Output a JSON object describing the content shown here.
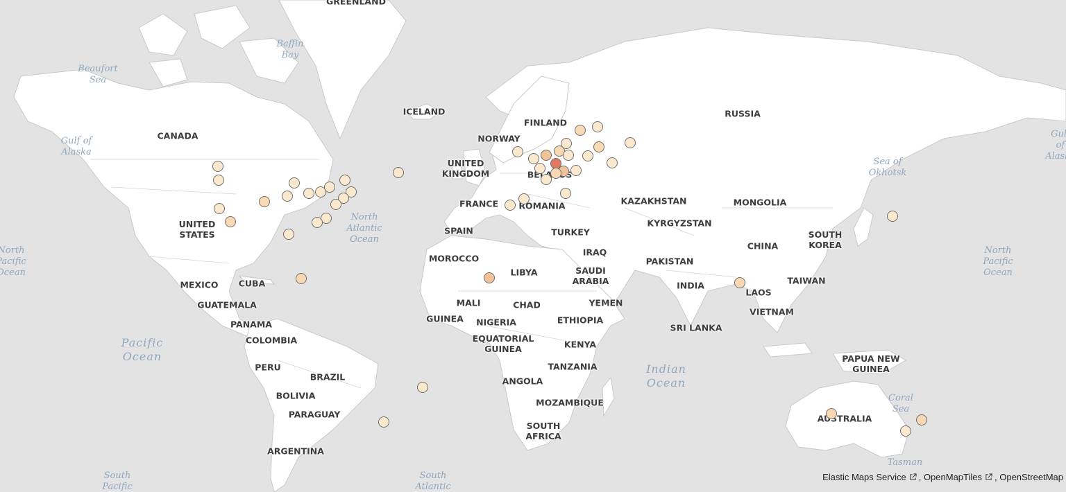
{
  "map": {
    "country_labels": [
      "GREENLAND",
      "ICELAND",
      "CANADA",
      "UNITED STATES",
      "MEXICO",
      "CUBA",
      "GUATEMALA",
      "PANAMA",
      "COLOMBIA",
      "PERU",
      "BRAZIL",
      "BOLIVIA",
      "PARAGUAY",
      "ARGENTINA",
      "NORWAY",
      "FINLAND",
      "UNITED KINGDOM",
      "BELARUS",
      "FRANCE",
      "ROMANIA",
      "SPAIN",
      "MOROCCO",
      "LIBYA",
      "TURKEY",
      "IRAQ",
      "SAUDI ARABIA",
      "YEMEN",
      "MALI",
      "CHAD",
      "GUINEA",
      "NIGERIA",
      "ETHIOPIA",
      "EQUATORIAL GUINEA",
      "KENYA",
      "TANZANIA",
      "ANGOLA",
      "MOZAMBIQUE",
      "SOUTH AFRICA",
      "RUSSIA",
      "KAZAKHSTAN",
      "KYRGYZSTAN",
      "MONGOLIA",
      "CHINA",
      "SOUTH KOREA",
      "PAKISTAN",
      "INDIA",
      "SRI LANKA",
      "LAOS",
      "VIETNAM",
      "TAIWAN",
      "PAPUA NEW GUINEA",
      "AUSTRALIA"
    ],
    "water_labels": [
      "Beaufort Sea",
      "Baffin Bay",
      "Gulf of Alaska",
      "North Atlantic Ocean",
      "North Pacific Ocean",
      "North Pacific Ocean",
      "Pacific Ocean",
      "Indian Ocean",
      "Sea of Okhotsk",
      "Coral Sea",
      "Tasman",
      "South Pacific",
      "South Atlantic",
      "Gulf of Alaska"
    ],
    "points": [
      {
        "lat": 49.3,
        "lon": -123.1,
        "level": 1
      },
      {
        "lat": 45.5,
        "lon": -122.7,
        "level": 1
      },
      {
        "lat": 37.8,
        "lon": -122.4,
        "level": 1
      },
      {
        "lat": 34.0,
        "lon": -118.2,
        "level": 2
      },
      {
        "lat": 39.7,
        "lon": -105.0,
        "level": 2
      },
      {
        "lat": 41.2,
        "lon": -96.0,
        "level": 1
      },
      {
        "lat": 44.9,
        "lon": -93.2,
        "level": 1
      },
      {
        "lat": 41.9,
        "lon": -87.6,
        "level": 1
      },
      {
        "lat": 42.3,
        "lon": -83.0,
        "level": 1
      },
      {
        "lat": 43.7,
        "lon": -79.4,
        "level": 1
      },
      {
        "lat": 45.5,
        "lon": -73.6,
        "level": 1
      },
      {
        "lat": 42.4,
        "lon": -71.1,
        "level": 1
      },
      {
        "lat": 40.7,
        "lon": -74.0,
        "level": 1
      },
      {
        "lat": 38.9,
        "lon": -77.0,
        "level": 1
      },
      {
        "lat": 35.2,
        "lon": -80.8,
        "level": 1
      },
      {
        "lat": 33.7,
        "lon": -84.4,
        "level": 1
      },
      {
        "lat": 29.7,
        "lon": -95.4,
        "level": 1
      },
      {
        "lat": 47.6,
        "lon": -52.7,
        "level": 1
      },
      {
        "lat": 14.6,
        "lon": -90.5,
        "level": 2
      },
      {
        "lat": -22.9,
        "lon": -43.2,
        "level": 1
      },
      {
        "lat": -34.6,
        "lon": -58.4,
        "level": 1
      },
      {
        "lat": 14.7,
        "lon": -17.4,
        "level": 3
      },
      {
        "lat": 53.3,
        "lon": -6.3,
        "level": 1
      },
      {
        "lat": 51.5,
        "lon": -0.1,
        "level": 1
      },
      {
        "lat": 48.9,
        "lon": 2.3,
        "level": 1
      },
      {
        "lat": 45.8,
        "lon": 4.8,
        "level": 1
      },
      {
        "lat": 40.4,
        "lon": -3.7,
        "level": 1
      },
      {
        "lat": 38.7,
        "lon": -9.1,
        "level": 1
      },
      {
        "lat": 52.4,
        "lon": 4.9,
        "level": 3
      },
      {
        "lat": 53.6,
        "lon": 10.0,
        "level": 2
      },
      {
        "lat": 50.1,
        "lon": 8.7,
        "level": 5
      },
      {
        "lat": 48.1,
        "lon": 11.6,
        "level": 3
      },
      {
        "lat": 47.4,
        "lon": 8.5,
        "level": 2
      },
      {
        "lat": 52.5,
        "lon": 13.4,
        "level": 1
      },
      {
        "lat": 48.2,
        "lon": 16.4,
        "level": 1
      },
      {
        "lat": 41.9,
        "lon": 12.5,
        "level": 1
      },
      {
        "lat": 55.7,
        "lon": 12.6,
        "level": 1
      },
      {
        "lat": 52.2,
        "lon": 21.0,
        "level": 1
      },
      {
        "lat": 59.3,
        "lon": 18.1,
        "level": 2
      },
      {
        "lat": 60.2,
        "lon": 24.9,
        "level": 1
      },
      {
        "lat": 54.7,
        "lon": 25.3,
        "level": 2
      },
      {
        "lat": 50.4,
        "lon": 30.5,
        "level": 1
      },
      {
        "lat": 55.8,
        "lon": 37.6,
        "level": 1
      },
      {
        "lat": 13.1,
        "lon": 80.3,
        "level": 2
      },
      {
        "lat": 35.7,
        "lon": 139.7,
        "level": 1
      },
      {
        "lat": -31.9,
        "lon": 115.9,
        "level": 2
      },
      {
        "lat": -37.8,
        "lon": 144.9,
        "level": 1
      },
      {
        "lat": -33.9,
        "lon": 151.2,
        "level": 2
      }
    ],
    "colors": {
      "water": "#e3e3e3",
      "land": "#ffffff",
      "ramp": [
        "#fbe9cf",
        "#f8d9b4",
        "#f2c298",
        "#ec9f7b",
        "#e07863"
      ]
    }
  },
  "attribution": {
    "items": [
      "Elastic Maps Service",
      ", OpenMapTiles",
      ", OpenStreetMap"
    ]
  }
}
